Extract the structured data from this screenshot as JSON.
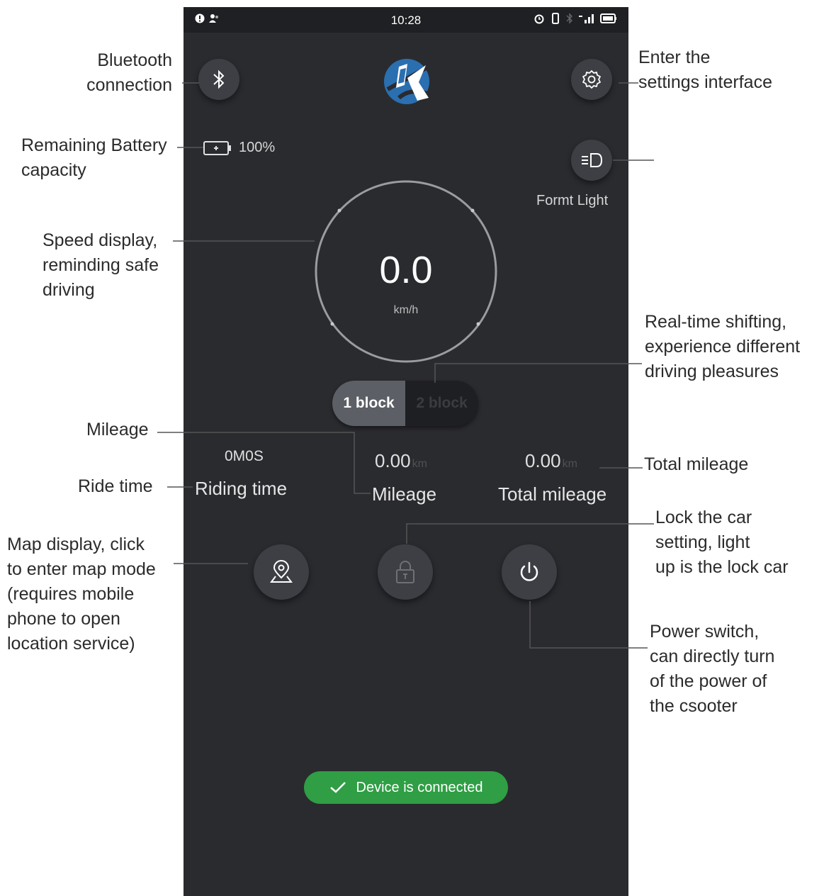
{
  "status_bar": {
    "time": "10:28"
  },
  "battery": {
    "level_text": "100%",
    "level": 100
  },
  "front_light": {
    "label": "Formt Light"
  },
  "speed": {
    "value": "0.0",
    "unit": "km/h"
  },
  "gear": {
    "options": [
      "1 block",
      "2 block"
    ],
    "selected": "1 block"
  },
  "stats": {
    "ride_time": {
      "value": "0M0S",
      "label": "Riding time"
    },
    "mileage": {
      "value": "0.00",
      "unit": "km",
      "label": "Mileage"
    },
    "total_mileage": {
      "value": "0.00",
      "unit": "km",
      "label": "Total mileage"
    }
  },
  "toast": {
    "text": "Device is connected",
    "color": "#2f9e44"
  },
  "annotations": {
    "bluetooth": [
      "Bluetooth",
      "connection"
    ],
    "settings": [
      "Enter the",
      "settings interface"
    ],
    "battery": [
      "Remaining Battery",
      "capacity"
    ],
    "speed": [
      "Speed display,",
      "reminding safe",
      "driving"
    ],
    "shifting": [
      "Real-time shifting,",
      "experience different",
      "driving pleasures"
    ],
    "mileage": "Mileage",
    "ride_time": "Ride time",
    "total_mileage": "Total mileage",
    "lock": [
      "Lock the car",
      "setting, light",
      "up is the lock car"
    ],
    "map": [
      "Map display, click",
      "to enter map mode",
      "(requires mobile",
      "phone to open",
      "location service)"
    ],
    "power": [
      "Power switch,",
      "can directly turn",
      "of the power of",
      "the csooter"
    ]
  },
  "icons": {
    "bluetooth": "bluetooth-icon",
    "settings": "gear-icon",
    "battery": "battery-icon",
    "light": "headlight-icon",
    "map": "map-pin-icon",
    "lock": "lock-icon",
    "power": "power-icon",
    "toast": "checkmark-icon",
    "logo": "brand-logo"
  }
}
